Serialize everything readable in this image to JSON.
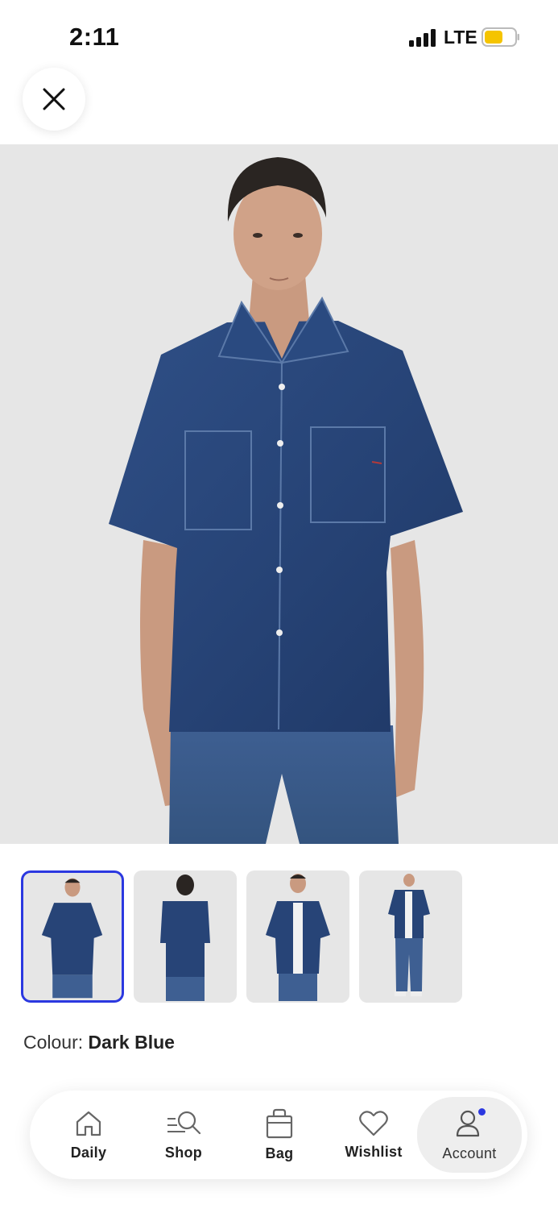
{
  "status_bar": {
    "time": "2:11",
    "network": "LTE",
    "battery_color": "#f5c400"
  },
  "close_icon": "close-icon",
  "product": {
    "colour_label": "Colour:",
    "colour_value": "Dark Blue",
    "thumbnails": [
      "front-view",
      "back-view",
      "open-shirt-view",
      "full-length-view"
    ],
    "selected_thumbnail": 0
  },
  "nav": {
    "items": [
      {
        "label": "Daily",
        "icon": "home-icon"
      },
      {
        "label": "Shop",
        "icon": "search-icon"
      },
      {
        "label": "Bag",
        "icon": "bag-icon"
      },
      {
        "label": "Wishlist",
        "icon": "heart-icon"
      },
      {
        "label": "Account",
        "icon": "account-icon"
      }
    ],
    "active": "Account",
    "accent_color": "#2b38e0"
  }
}
